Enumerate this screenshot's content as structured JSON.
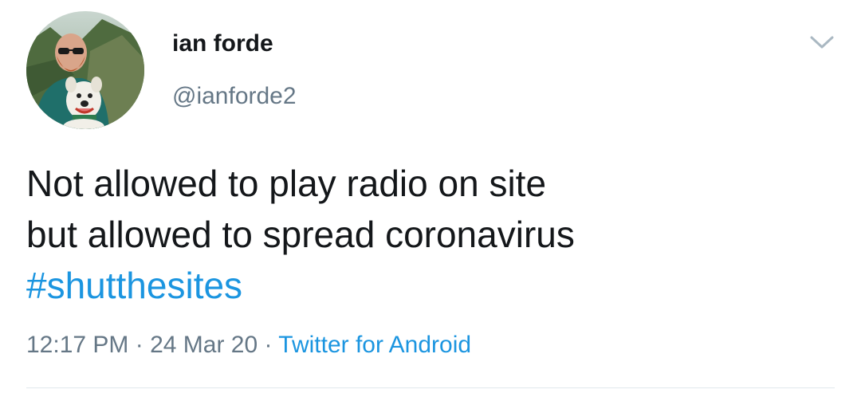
{
  "user": {
    "display_name": "ian forde",
    "handle": "@ianforde2",
    "avatar_icon": "profile-photo"
  },
  "tweet": {
    "lines": [
      "Not allowed to play radio on site",
      "but allowed to spread coronavirus"
    ],
    "hashtag": "#shutthesites"
  },
  "meta": {
    "time": "12:17 PM",
    "separator1": " · ",
    "date": "24 Mar 20",
    "separator2": " · ",
    "source": "Twitter for Android"
  },
  "menu_icon": "chevron-down-icon",
  "colors": {
    "text": "#14171a",
    "secondary": "#657786",
    "link": "#1b95e0",
    "divider": "#e1e8ed",
    "caret": "#aab8c2"
  }
}
